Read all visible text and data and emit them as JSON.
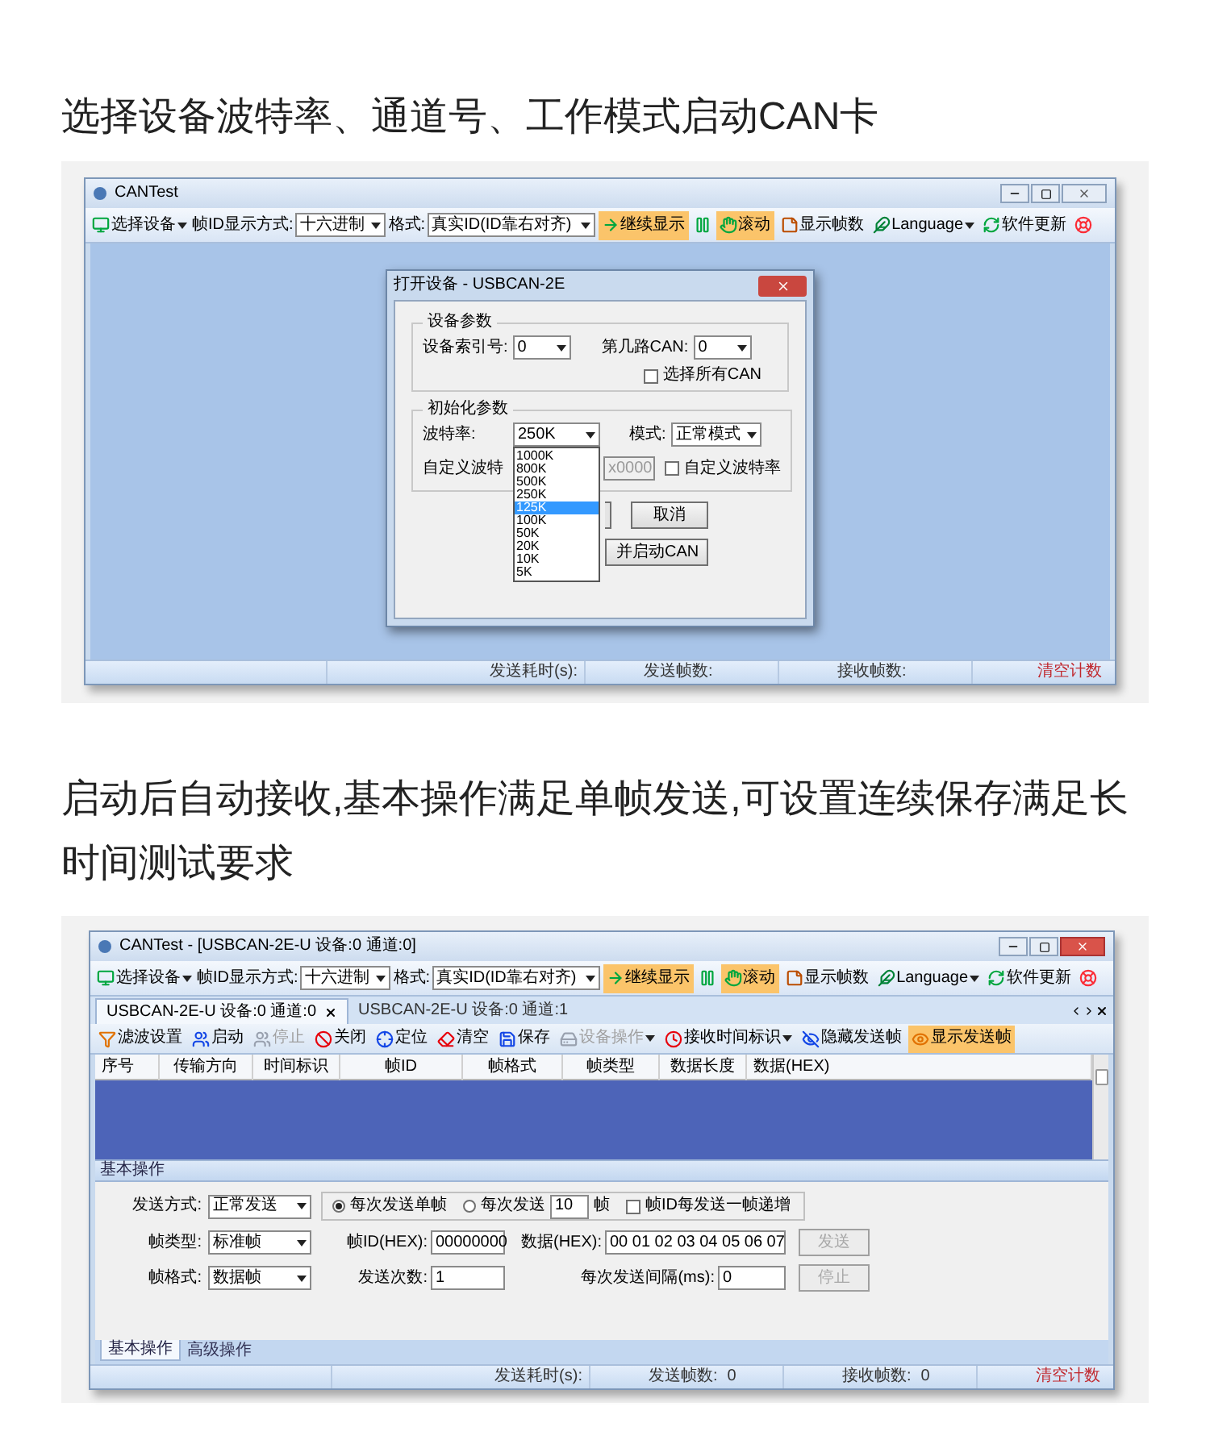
{
  "section_1": {
    "heading": "选择设备波特率、通道号、工作模式启动CAN卡",
    "window": {
      "title": "CANTest",
      "active": false,
      "toolbar": [
        {
          "kind": "menu",
          "label": "选择设备"
        },
        {
          "kind": "select",
          "label": "帧ID显示方式:",
          "value": "十六进制"
        },
        {
          "kind": "select",
          "label": "格式:",
          "value": "真实ID(ID靠右对齐)"
        },
        {
          "kind": "button",
          "label": "继续显示",
          "active": true
        },
        {
          "kind": "pause"
        },
        {
          "kind": "button",
          "label": "滚动",
          "active": true
        },
        {
          "kind": "button",
          "label": "显示帧数",
          "active": false
        },
        {
          "kind": "menu",
          "label": "Language"
        },
        {
          "kind": "button",
          "label": "软件更新",
          "active": false
        },
        {
          "kind": "help"
        }
      ],
      "dialog": {
        "title": "打开设备 - USBCAN-2E",
        "device_group": {
          "title": "设备参数",
          "index_label": "设备索引号:",
          "index_value": "0",
          "channel_label": "第几路CAN:",
          "channel_value": "0",
          "all_channels": {
            "label": "选择所有CAN",
            "checked": false
          }
        },
        "init_group": {
          "title": "初始化参数",
          "baud_label": "波特率:",
          "baud_value": "250K",
          "mode_label": "模式:",
          "mode_value": "正常模式",
          "custom_label": "自定义波特",
          "custom_value": "x0000",
          "custom_baud": {
            "label": "自定义波特率",
            "checked": false
          },
          "baud_options": [
            {
              "label": "1000K",
              "selected": false
            },
            {
              "label": "800K",
              "selected": false
            },
            {
              "label": "500K",
              "selected": false
            },
            {
              "label": "250K",
              "selected": false
            },
            {
              "label": "125K",
              "selected": true
            },
            {
              "label": "100K",
              "selected": false
            },
            {
              "label": "50K",
              "selected": false
            },
            {
              "label": "20K",
              "selected": false
            },
            {
              "label": "10K",
              "selected": false
            },
            {
              "label": "5K",
              "selected": false
            }
          ]
        },
        "button_rows": [
          [
            {
              "kind": "edge"
            },
            {
              "kind": "button",
              "label": "取消"
            }
          ],
          [
            {
              "kind": "button",
              "label": "并启动CAN"
            }
          ]
        ]
      },
      "status_bar": [
        {
          "kind": "text",
          "label": "发送耗时(s):"
        },
        {
          "kind": "text",
          "label": "发送帧数:"
        },
        {
          "kind": "text",
          "label": "接收帧数:"
        },
        {
          "kind": "link",
          "label": "清空计数"
        }
      ]
    }
  },
  "section_2": {
    "heading": "启动后自动接收,基本操作满足单帧发送,可设置连续保存满足长时间测试要求",
    "window": {
      "title": "CANTest - [USBCAN-2E-U 设备:0 通道:0]",
      "active": true,
      "toolbar": [
        {
          "kind": "menu",
          "label": "选择设备"
        },
        {
          "kind": "select",
          "label": "帧ID显示方式:",
          "value": "十六进制"
        },
        {
          "kind": "select",
          "label": "格式:",
          "value": "真实ID(ID靠右对齐)"
        },
        {
          "kind": "button",
          "label": "继续显示",
          "active": true
        },
        {
          "kind": "pause"
        },
        {
          "kind": "button",
          "label": "滚动",
          "active": true
        },
        {
          "kind": "button",
          "label": "显示帧数",
          "active": false
        },
        {
          "kind": "menu",
          "label": "Language"
        },
        {
          "kind": "button",
          "label": "软件更新",
          "active": false
        },
        {
          "kind": "help"
        }
      ],
      "tabs": [
        {
          "label": "USBCAN-2E-U 设备:0 通道:0",
          "selected": true
        },
        {
          "label": "USBCAN-2E-U 设备:0 通道:1",
          "selected": false
        }
      ],
      "actions": [
        {
          "kind": "button",
          "label": "滤波设置",
          "disabled": false,
          "active": false
        },
        {
          "kind": "button",
          "label": "启动",
          "disabled": false,
          "active": false
        },
        {
          "kind": "button",
          "label": "停止",
          "disabled": true,
          "active": false
        },
        {
          "kind": "button",
          "label": "关闭",
          "disabled": false,
          "active": false
        },
        {
          "kind": "button",
          "label": "定位",
          "disabled": false,
          "active": false
        },
        {
          "kind": "button",
          "label": "清空",
          "disabled": false,
          "active": false
        },
        {
          "kind": "button",
          "label": "保存",
          "disabled": false,
          "active": false
        },
        {
          "kind": "menu",
          "label": "设备操作",
          "disabled": true,
          "active": false
        },
        {
          "kind": "menu",
          "label": "接收时间标识",
          "disabled": false,
          "active": false
        },
        {
          "kind": "button",
          "label": "隐藏发送帧",
          "disabled": false,
          "active": false
        },
        {
          "kind": "button",
          "label": "显示发送帧",
          "disabled": false,
          "active": true
        }
      ],
      "table": {
        "columns": [
          "序号",
          "传输方向",
          "时间标识",
          "帧ID",
          "帧格式",
          "帧类型",
          "数据长度",
          "数据(HEX)"
        ]
      },
      "send_panel": {
        "title": "基本操作",
        "send_mode": {
          "label": "发送方式:",
          "value": "正常发送"
        },
        "options": [
          {
            "kind": "radio",
            "label": "每次发送单帧",
            "selected": true
          },
          {
            "kind": "radio",
            "label": "每次发送",
            "selected": false,
            "count": "10",
            "unit": "帧"
          },
          {
            "kind": "checkbox",
            "label": "帧ID每发送一帧递增",
            "checked": false
          }
        ],
        "frame_type": {
          "label": "帧类型:",
          "value": "标准帧"
        },
        "frame_format": {
          "label": "帧格式:",
          "value": "数据帧"
        },
        "frame_id": {
          "label": "帧ID(HEX):",
          "value": "00000000"
        },
        "data": {
          "label": "数据(HEX):",
          "value": "00 01 02 03 04 05 06 07"
        },
        "send_count": {
          "label": "发送次数:",
          "value": "1"
        },
        "interval": {
          "label": "每次发送间隔(ms):",
          "value": "0"
        },
        "buttons": [
          {
            "label": "发送",
            "disabled": true
          },
          {
            "label": "停止",
            "disabled": true
          }
        ]
      },
      "bottom_tabs": [
        {
          "label": "基本操作",
          "selected": true
        },
        {
          "label": "高级操作",
          "selected": false
        }
      ],
      "status_bar": [
        {
          "kind": "text",
          "label": "发送耗时(s):"
        },
        {
          "kind": "text",
          "label": "发送帧数:",
          "value": "0"
        },
        {
          "kind": "text",
          "label": "接收帧数:",
          "value": "0"
        },
        {
          "kind": "link",
          "label": "清空计数"
        }
      ]
    }
  }
}
